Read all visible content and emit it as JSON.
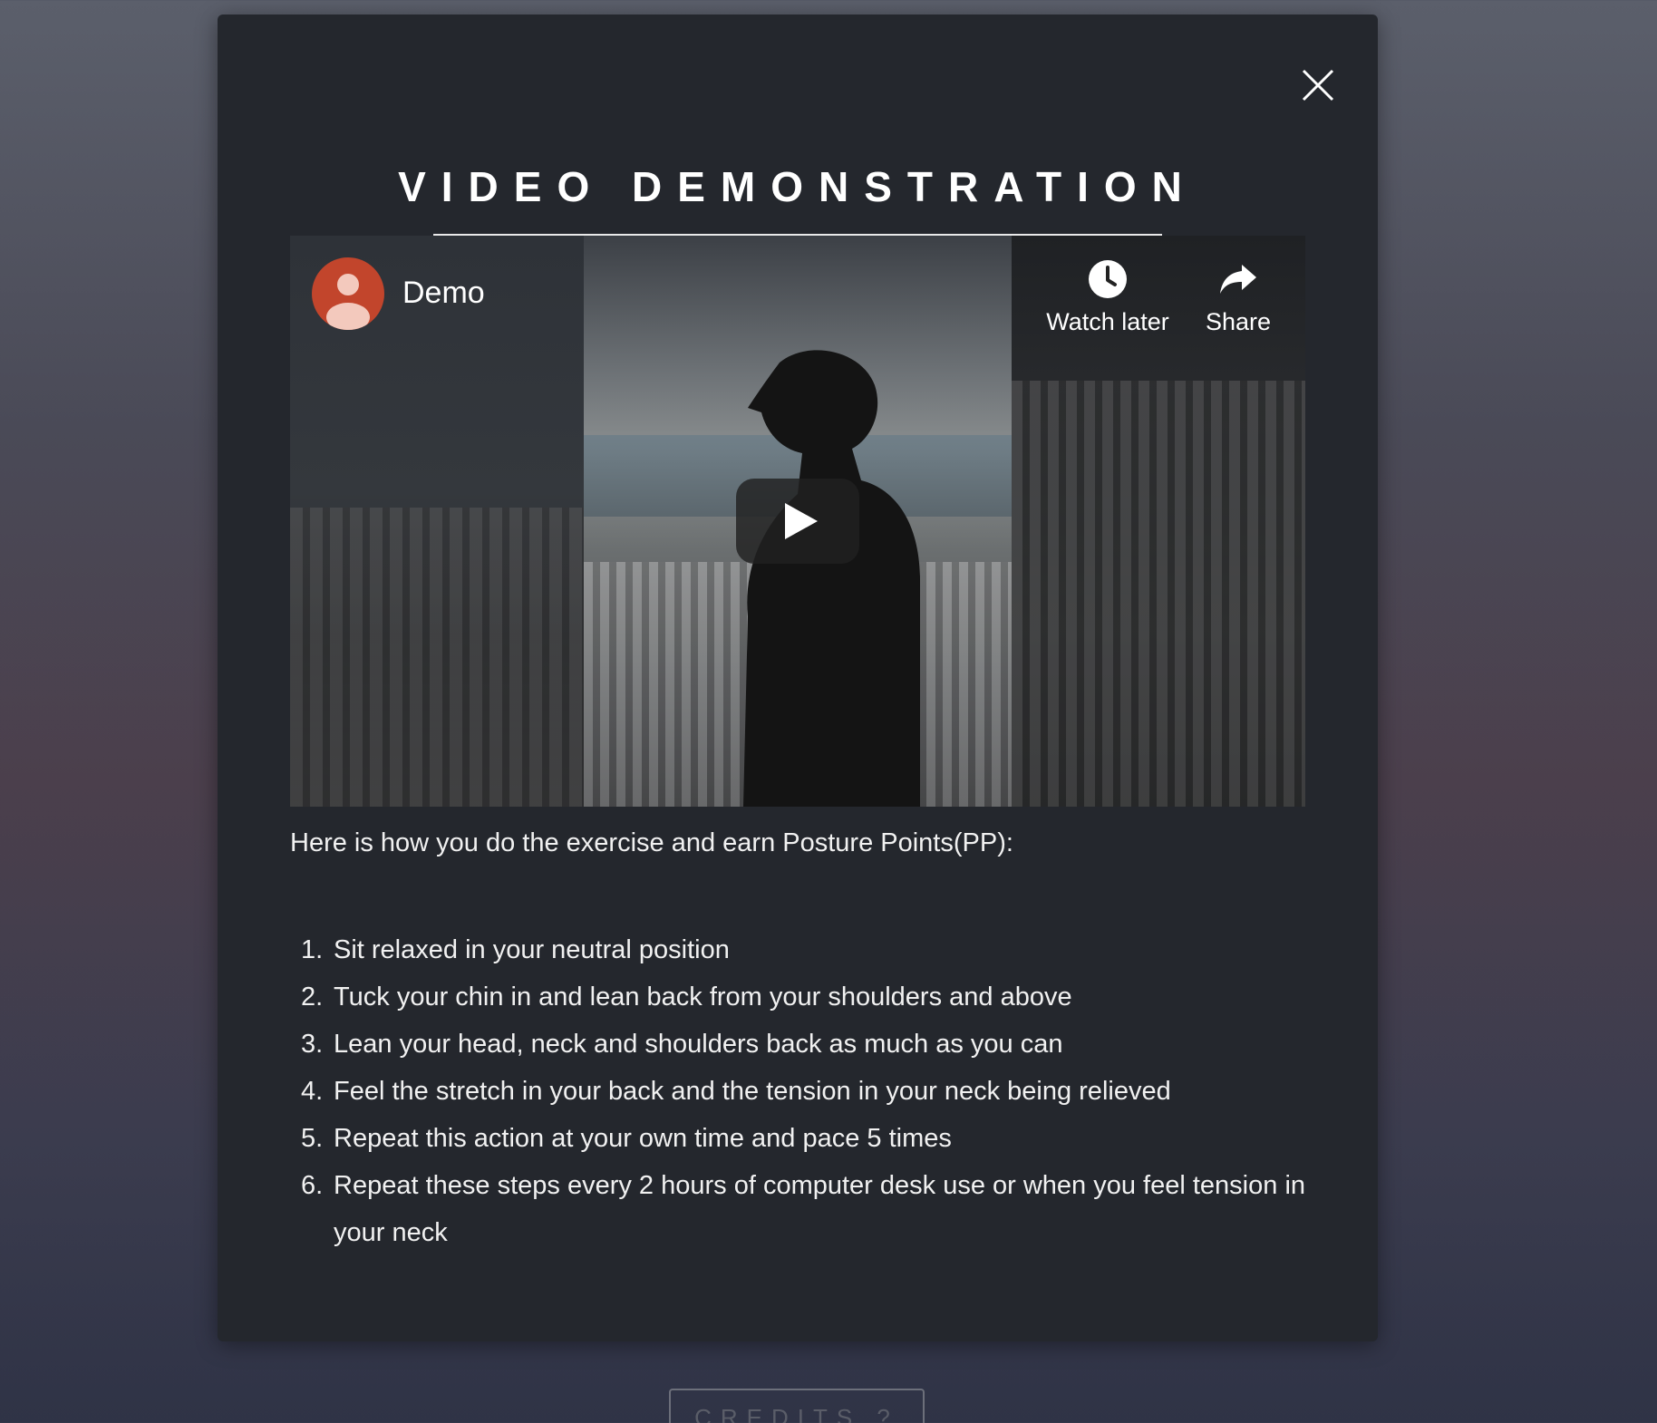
{
  "modal": {
    "title": "VIDEO DEMONSTRATION",
    "close_icon": "close-icon"
  },
  "video": {
    "channel_name": "Demo",
    "watch_later_label": "Watch later",
    "share_label": "Share",
    "avatar_color": "#c2452c"
  },
  "content": {
    "intro": "Here is how you do the exercise and earn Posture Points(PP):",
    "steps": [
      {
        "num": "1.",
        "text": "Sit relaxed in your neutral position"
      },
      {
        "num": "2.",
        "text": "Tuck your chin in and lean back from your shoulders and above"
      },
      {
        "num": "3.",
        "text": "Lean your head, neck and shoulders back as much as you can"
      },
      {
        "num": "4.",
        "text": "Feel the stretch in your back and the tension in your neck being relieved"
      },
      {
        "num": "5.",
        "text": "Repeat this action at your own time and pace 5 times"
      },
      {
        "num": "6.",
        "text": "Repeat these steps every 2 hours of computer desk use or when you feel tension in your neck"
      }
    ]
  },
  "footer": {
    "credits_label": "CREDITS ?"
  }
}
